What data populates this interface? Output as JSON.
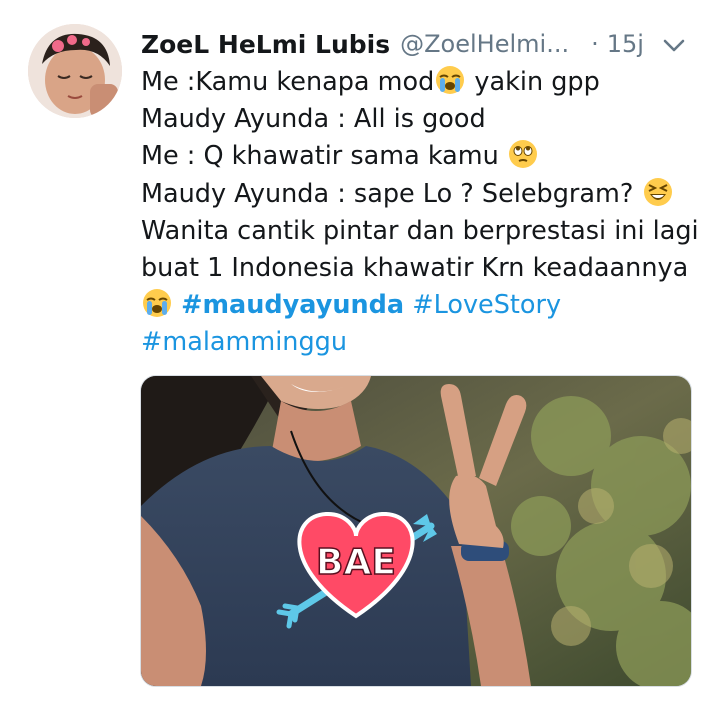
{
  "tweet": {
    "author_name": "ZoeL HeLmi Lubis",
    "handle": "@ZoelHelmi...",
    "separator": "·",
    "time": "15j",
    "lines": [
      {
        "before": "Me :Kamu kenapa mod",
        "emoji": "loudly-crying-face-emoji",
        "after": " yakin gpp"
      },
      {
        "text": "Maudy Ayunda : All is good"
      },
      {
        "before": "Me : Q khawatir sama kamu ",
        "emoji": "face-with-rolling-eyes-emoji",
        "after": ""
      },
      {
        "before": "Maudy Ayunda : sape Lo ? Selebgram? ",
        "emoji": "grinning-squinting-face-emoji",
        "after": ""
      },
      {
        "text": "Wanita cantik pintar dan berprestasi ini lagi"
      },
      {
        "text": "buat 1 Indonesia khawatir Krn keadaannya"
      }
    ],
    "hashtags": [
      "#maudyayunda",
      "#LoveStory",
      "#malamminggu"
    ]
  },
  "photo": {
    "sticker_text": "BAE",
    "sticker_color": "#ff4a66",
    "arrow_color": "#5ec8e8"
  },
  "colors": {
    "link": "#1b95e0",
    "secondary": "#657786",
    "text": "#14171a"
  },
  "icons": {
    "caret": "chevron-down-icon"
  }
}
